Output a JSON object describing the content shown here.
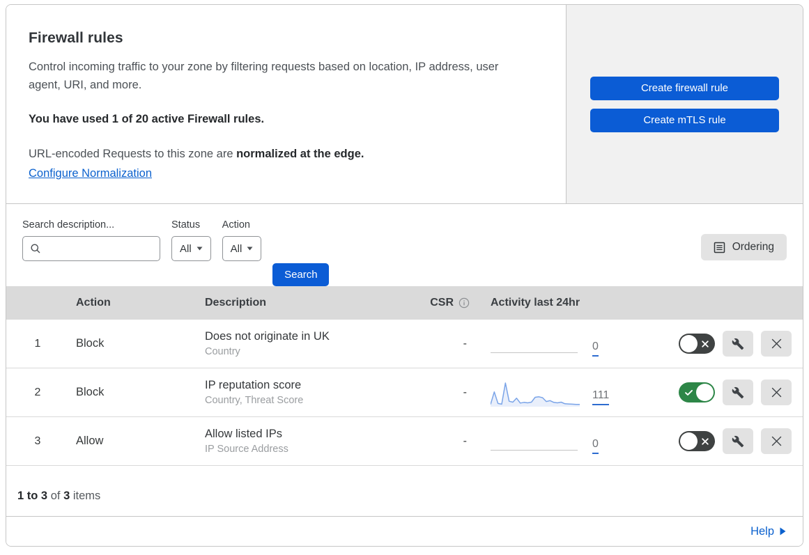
{
  "header": {
    "title": "Firewall rules",
    "description": "Control incoming traffic to your zone by filtering requests based on location, IP address, user agent, URI, and more.",
    "usage_line": "You have used 1 of 20 active Firewall rules.",
    "normalization_text": "URL-encoded Requests to this zone are ",
    "normalization_bold": "normalized at the edge.",
    "configure_link": "Configure Normalization"
  },
  "actions": {
    "create_firewall_rule": "Create firewall rule",
    "create_mtls_rule": "Create mTLS rule"
  },
  "filters": {
    "search_label": "Search description...",
    "status_label": "Status",
    "status_value": "All",
    "action_label": "Action",
    "action_value": "All",
    "search_button": "Search",
    "ordering_button": "Ordering"
  },
  "table": {
    "columns": {
      "action": "Action",
      "description": "Description",
      "csr": "CSR",
      "activity": "Activity last 24hr"
    },
    "rows": [
      {
        "priority": "1",
        "action": "Block",
        "description": "Does not originate in UK",
        "fields": "Country",
        "csr": "-",
        "activity_count": "0",
        "enabled": false,
        "sparkline": []
      },
      {
        "priority": "2",
        "action": "Block",
        "description": "IP reputation score",
        "fields": "Country, Threat Score",
        "csr": "-",
        "activity_count": "111",
        "enabled": true,
        "sparkline": [
          4,
          60,
          8,
          5,
          100,
          18,
          14,
          32,
          10,
          13,
          11,
          14,
          36,
          38,
          34,
          17,
          21,
          13,
          11,
          14,
          7,
          6,
          5,
          4,
          4
        ]
      },
      {
        "priority": "3",
        "action": "Allow",
        "description": "Allow listed IPs",
        "fields": "IP Source Address",
        "csr": "-",
        "activity_count": "0",
        "enabled": false,
        "sparkline": []
      }
    ]
  },
  "footer": {
    "range": "1 to 3",
    "of": "of",
    "total": "3",
    "items": "items"
  },
  "help": {
    "label": "Help"
  },
  "colors": {
    "accent": "#0b5cd5",
    "link": "#0b61ce",
    "toggle_on": "#2d8647",
    "toggle_off": "#3f4242",
    "sparkline_line": "#7aa4e8",
    "sparkline_fill": "#e9effb",
    "table_header_bg": "#dadada",
    "panel_bg": "#f1f1f1"
  }
}
